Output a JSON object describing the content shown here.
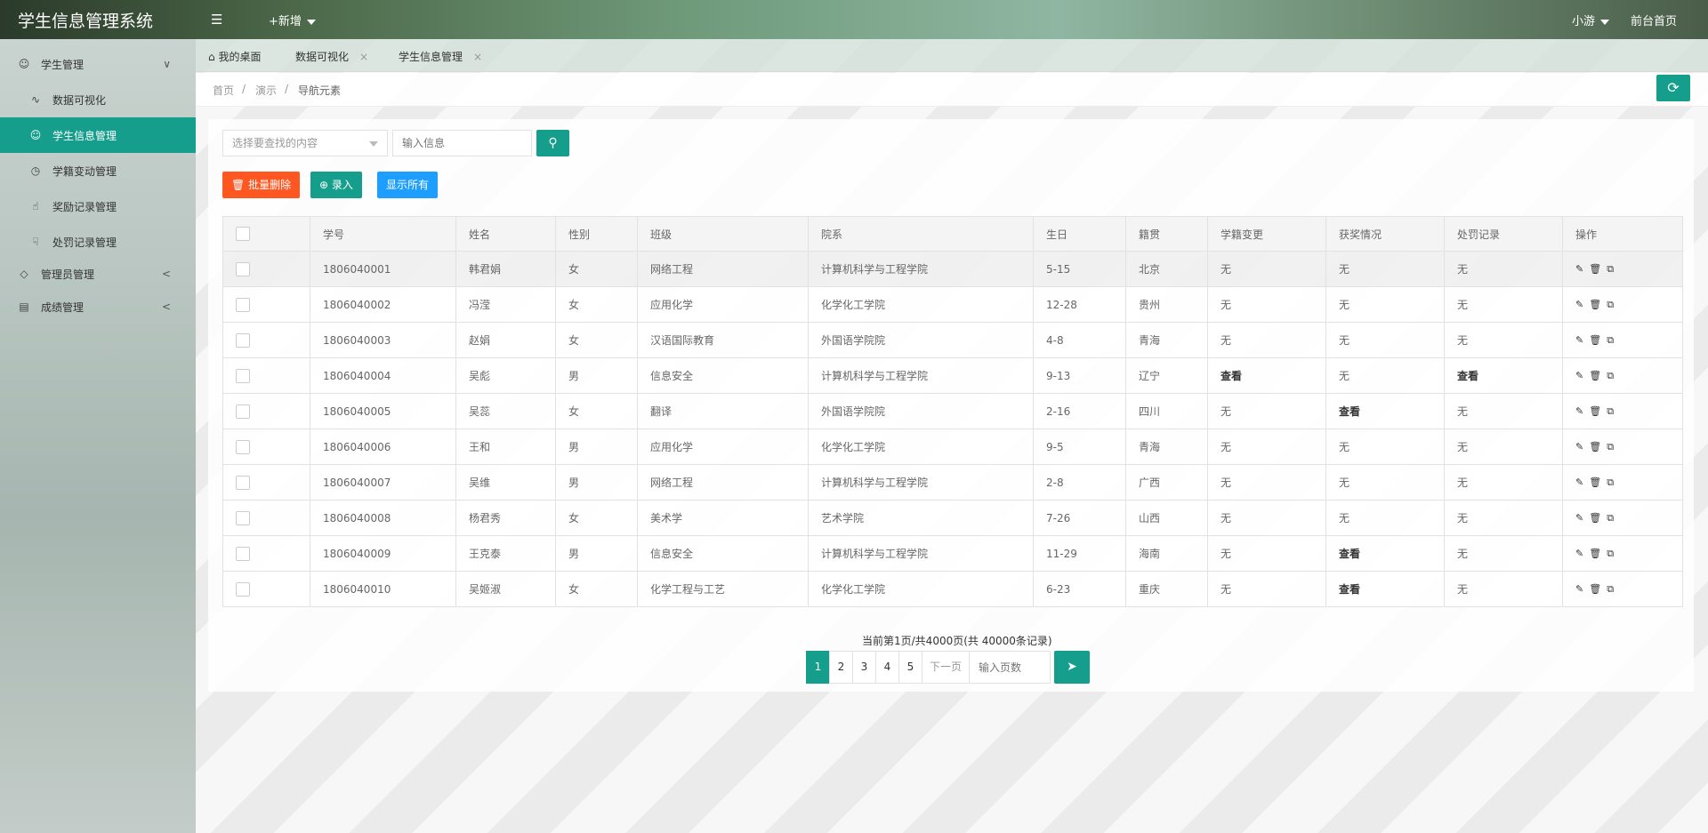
{
  "header": {
    "app_title": "学生信息管理系统",
    "menu_icon": "hamburger-icon",
    "add_new": "+新增",
    "user": "小游",
    "front_home": "前台首页"
  },
  "sidebar": {
    "items": [
      {
        "label": "学生管理",
        "icon": "user-icon",
        "arrow": "∨"
      },
      {
        "label": "数据可视化",
        "icon": "pulse-icon"
      },
      {
        "label": "学生信息管理",
        "icon": "user-icon"
      },
      {
        "label": "学籍变动管理",
        "icon": "clock-icon"
      },
      {
        "label": "奖励记录管理",
        "icon": "thumbs-up-icon"
      },
      {
        "label": "处罚记录管理",
        "icon": "thumbs-down-icon"
      },
      {
        "label": "管理员管理",
        "icon": "diamond-icon",
        "arrow": "<"
      },
      {
        "label": "成绩管理",
        "icon": "report-icon",
        "arrow": "<"
      }
    ]
  },
  "tabs": [
    {
      "label": "我的桌面"
    },
    {
      "label": "数据可视化",
      "close": "×"
    },
    {
      "label": "学生信息管理",
      "close": "×"
    }
  ],
  "breadcrumb": [
    "首页",
    "演示",
    "导航元素"
  ],
  "breadcrumb_sep": "/",
  "search": {
    "select_placeholder": "选择要查找的内容",
    "input_placeholder": "输入信息"
  },
  "buttons": {
    "batch_delete": "批量删除",
    "add": "录入",
    "show_all": "显示所有"
  },
  "table": {
    "columns": [
      "学号",
      "姓名",
      "性别",
      "班级",
      "院系",
      "生日",
      "籍贯",
      "学籍变更",
      "获奖情况",
      "处罚记录",
      "操作"
    ],
    "rows": [
      [
        "1806040001",
        "韩君娟",
        "女",
        "网络工程",
        "计算机科学与工程学院",
        "5-15",
        "北京",
        "无",
        "无",
        "无"
      ],
      [
        "1806040002",
        "冯滢",
        "女",
        "应用化学",
        "化学化工学院",
        "12-28",
        "贵州",
        "无",
        "无",
        "无"
      ],
      [
        "1806040003",
        "赵娟",
        "女",
        "汉语国际教育",
        "外国语学院院",
        "4-8",
        "青海",
        "无",
        "无",
        "无"
      ],
      [
        "1806040004",
        "吴彪",
        "男",
        "信息安全",
        "计算机科学与工程学院",
        "9-13",
        "辽宁",
        "查看",
        "无",
        "查看"
      ],
      [
        "1806040005",
        "吴蕊",
        "女",
        "翻译",
        "外国语学院院",
        "2-16",
        "四川",
        "无",
        "查看",
        "无"
      ],
      [
        "1806040006",
        "王和",
        "男",
        "应用化学",
        "化学化工学院",
        "9-5",
        "青海",
        "无",
        "无",
        "无"
      ],
      [
        "1806040007",
        "吴维",
        "男",
        "网络工程",
        "计算机科学与工程学院",
        "2-8",
        "广西",
        "无",
        "无",
        "无"
      ],
      [
        "1806040008",
        "杨君秀",
        "女",
        "美术学",
        "艺术学院",
        "7-26",
        "山西",
        "无",
        "无",
        "无"
      ],
      [
        "1806040009",
        "王克泰",
        "男",
        "信息安全",
        "计算机科学与工程学院",
        "11-29",
        "海南",
        "无",
        "查看",
        "无"
      ],
      [
        "1806040010",
        "吴姬淑",
        "女",
        "化学工程与工艺",
        "化学化工学院",
        "6-23",
        "重庆",
        "无",
        "查看",
        "无"
      ]
    ]
  },
  "pagination": {
    "info": "当前第1页/共4000页(共 40000条记录)",
    "pages": [
      "1",
      "2",
      "3",
      "4",
      "5"
    ],
    "next": "下一页",
    "input_placeholder": "输入页数"
  },
  "colors": {
    "accent": "#159e8b",
    "danger": "#ff5722",
    "info": "#1e9fff"
  }
}
